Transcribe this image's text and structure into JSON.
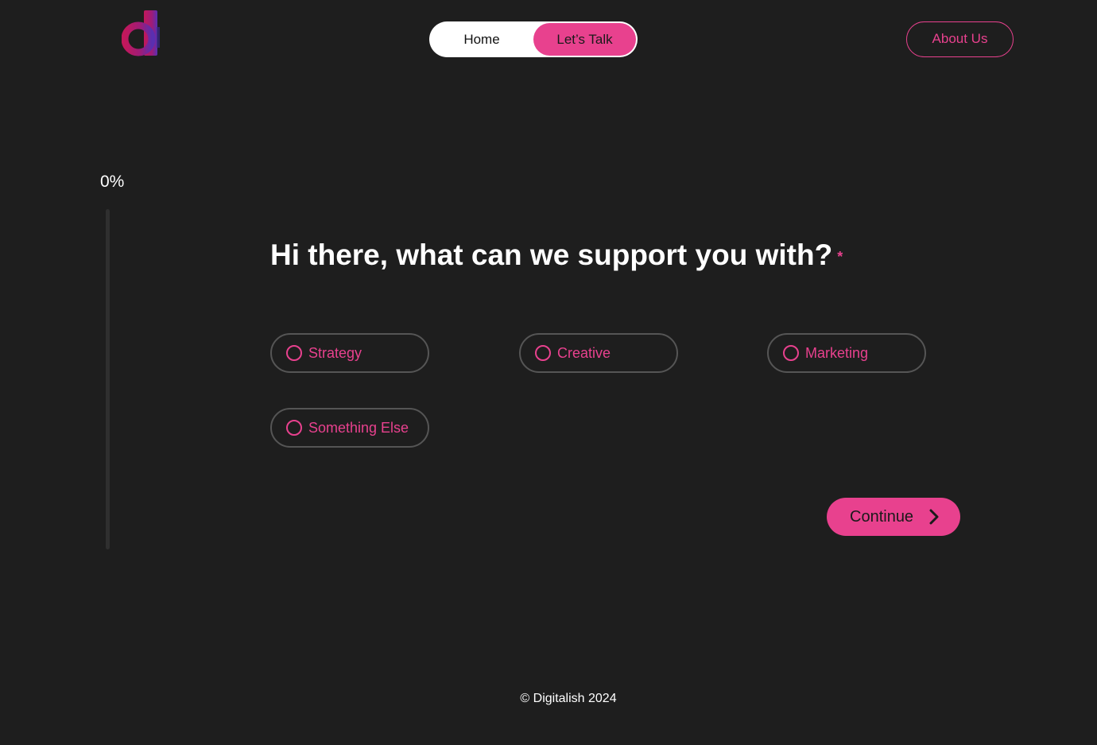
{
  "header": {
    "logo_icon": "digitalish-d-logo",
    "nav": {
      "home_label": "Home",
      "talk_label": "Let’s Talk"
    },
    "about_label": "About Us"
  },
  "progress": {
    "label": "0%",
    "value": 0
  },
  "form": {
    "question": "Hi there, what can we support you with?",
    "required_marker": "*",
    "options": [
      {
        "label": "Strategy"
      },
      {
        "label": "Creative"
      },
      {
        "label": "Marketing"
      },
      {
        "label": "Something Else"
      }
    ],
    "continue_label": "Continue",
    "continue_icon": "chevron-right-icon"
  },
  "footer": {
    "copyright": "© Digitalish 2024"
  },
  "colors": {
    "background": "#1e1e1e",
    "accent": "#e8418e",
    "option_border": "#555555",
    "text": "#ffffff"
  }
}
